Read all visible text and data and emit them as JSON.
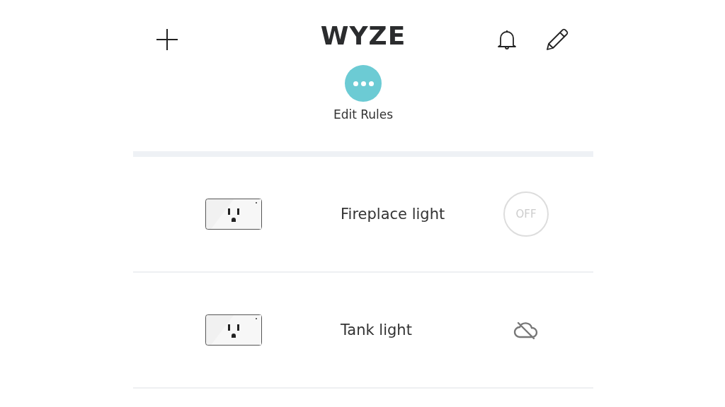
{
  "header": {
    "logo": "WYZE"
  },
  "rules_button": {
    "label": "Edit Rules"
  },
  "devices": [
    {
      "name": "Fireplace light",
      "kind": "toggle",
      "power_label": "OFF"
    },
    {
      "name": "Tank light",
      "kind": "offline"
    }
  ]
}
